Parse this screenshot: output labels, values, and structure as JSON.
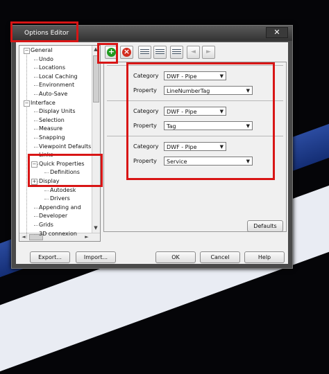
{
  "window": {
    "title": "Options Editor",
    "close_glyph": "✕"
  },
  "tree": {
    "items": [
      {
        "label": "General",
        "expander": "−"
      },
      {
        "label": "Undo"
      },
      {
        "label": "Locations"
      },
      {
        "label": "Local Caching"
      },
      {
        "label": "Environment"
      },
      {
        "label": "Auto-Save"
      },
      {
        "label": "Interface",
        "expander": "−"
      },
      {
        "label": "Display Units"
      },
      {
        "label": "Selection"
      },
      {
        "label": "Measure"
      },
      {
        "label": "Snapping"
      },
      {
        "label": "Viewpoint Defaults"
      },
      {
        "label": "Links"
      },
      {
        "label": "Quick Properties",
        "expander": "−"
      },
      {
        "label": "Definitions"
      },
      {
        "label": "Display",
        "expander": "+"
      },
      {
        "label": "Autodesk"
      },
      {
        "label": "Drivers"
      },
      {
        "label": "Appending and"
      },
      {
        "label": "Developer"
      },
      {
        "label": "Grids"
      },
      {
        "label": "3D connexion"
      }
    ],
    "scroll_up": "▲",
    "scroll_down": "▼",
    "scroll_left": "◄",
    "scroll_right": "►"
  },
  "toolbar": {
    "buttons": [
      {
        "name": "add-icon",
        "glyph": "+",
        "color": "#1f9a1f"
      },
      {
        "name": "remove-icon",
        "glyph": "×",
        "color": "#d22c1e"
      },
      {
        "name": "list-collapse-icon",
        "glyph": ""
      },
      {
        "name": "list-expand-icon",
        "glyph": ""
      },
      {
        "name": "swap-icon",
        "glyph": ""
      },
      {
        "name": "arrow-left-icon",
        "glyph": "◄"
      },
      {
        "name": "arrow-right-icon",
        "glyph": "►"
      }
    ]
  },
  "definitions": [
    {
      "category_label": "Category",
      "category_value": "DWF - Pipe",
      "property_label": "Property",
      "property_value": "LineNumberTag"
    },
    {
      "category_label": "Category",
      "category_value": "DWF - Pipe",
      "property_label": "Property",
      "property_value": "Tag"
    },
    {
      "category_label": "Category",
      "category_value": "DWF - Pipe",
      "property_label": "Property",
      "property_value": "Service"
    }
  ],
  "combo_arrow": "▼",
  "buttons": {
    "defaults": "Defaults",
    "export": "Export...",
    "import": "Import...",
    "ok": "OK",
    "cancel": "Cancel",
    "help": "Help"
  },
  "colors": {
    "highlight": "#d81515",
    "accent_blue": "#2d4fa8"
  }
}
